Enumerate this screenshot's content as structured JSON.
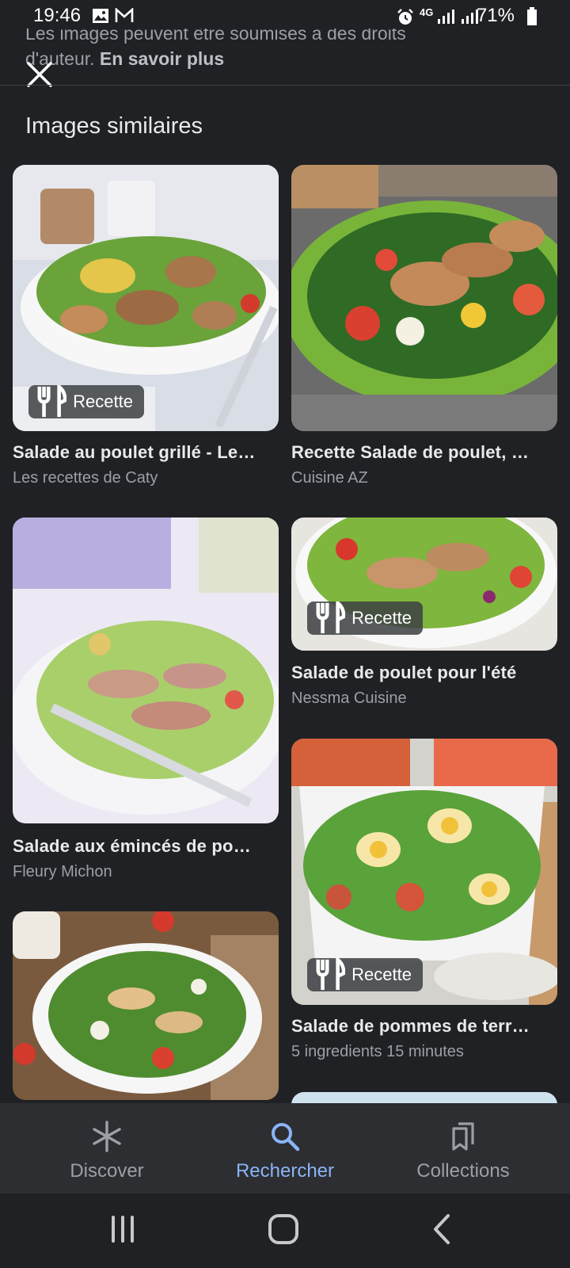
{
  "status_bar": {
    "time": "19:46",
    "network": "4G",
    "battery": "71%"
  },
  "disclaimer": {
    "line1": "Les images peuvent être soumises à des droits",
    "line2": "d'auteur.",
    "link": "En savoir plus"
  },
  "section_title": "Images similaires",
  "cards": [
    {
      "title": "Salade au poulet grillé - Le…",
      "source": "Les recettes de Caty",
      "chip": "Recette"
    },
    {
      "title": "Recette Salade de poulet, …",
      "source": "Cuisine AZ"
    },
    {
      "title": "Salade aux émincés de po…",
      "source": "Fleury Michon"
    },
    {
      "title": "Salade de poulet pour l'été",
      "source": "Nessma Cuisine",
      "chip": "Recette"
    },
    {
      "title": "Salade de pommes de terr…",
      "source": "5 ingredients 15 minutes",
      "chip": "Recette"
    },
    {
      "title": "",
      "source": ""
    }
  ],
  "bottom_nav": {
    "items": [
      {
        "label": "Discover",
        "icon": "asterisk-icon"
      },
      {
        "label": "Rechercher",
        "icon": "search-icon",
        "active": true
      },
      {
        "label": "Collections",
        "icon": "collections-icon"
      }
    ]
  },
  "colors": {
    "background": "#202124",
    "accent": "#8ab4f8",
    "nav_bg": "#2d2e31"
  }
}
